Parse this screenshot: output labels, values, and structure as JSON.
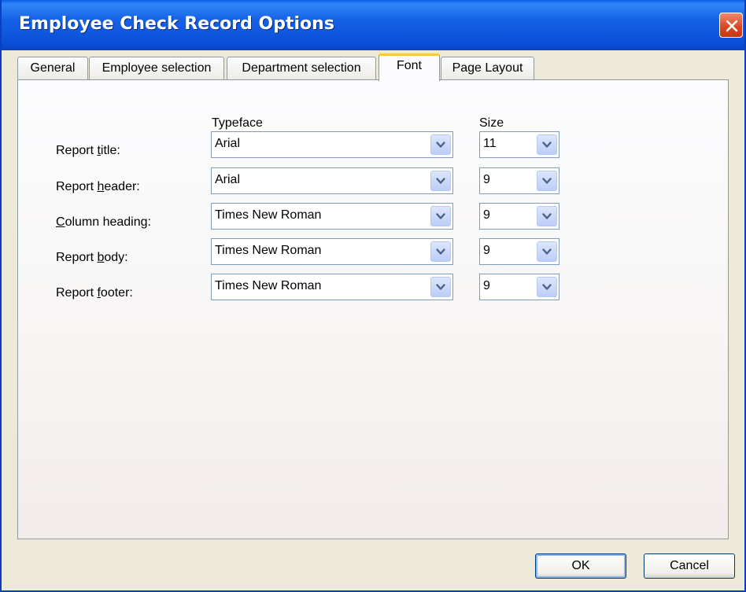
{
  "window": {
    "title": "Employee Check Record Options"
  },
  "tabs": [
    {
      "label": "General"
    },
    {
      "label": "Employee selection"
    },
    {
      "label": "Department selection"
    },
    {
      "label": "Font"
    },
    {
      "label": "Page Layout"
    }
  ],
  "active_tab": "Font",
  "columns": {
    "typeface": "Typeface",
    "size": "Size"
  },
  "rows": [
    {
      "label_pre": "Report ",
      "label_key": "t",
      "label_post": "itle:",
      "typeface": "Arial",
      "size": "11"
    },
    {
      "label_pre": "Report ",
      "label_key": "h",
      "label_post": "eader:",
      "typeface": "Arial",
      "size": "9"
    },
    {
      "label_pre": "",
      "label_key": "C",
      "label_post": "olumn heading:",
      "typeface": "Times New Roman",
      "size": "9"
    },
    {
      "label_pre": "Report ",
      "label_key": "b",
      "label_post": "ody:",
      "typeface": "Times New Roman",
      "size": "9"
    },
    {
      "label_pre": "Report ",
      "label_key": "f",
      "label_post": "ooter:",
      "typeface": "Times New Roman",
      "size": "9"
    }
  ],
  "buttons": {
    "ok": "OK",
    "cancel": "Cancel"
  },
  "colors": {
    "titlebar": "#0a5ee8",
    "active_tab_accent": "#ffc83c",
    "close": "#d8451f"
  },
  "icons": {
    "close": "close-icon",
    "dropdown": "chevron-down-icon"
  }
}
